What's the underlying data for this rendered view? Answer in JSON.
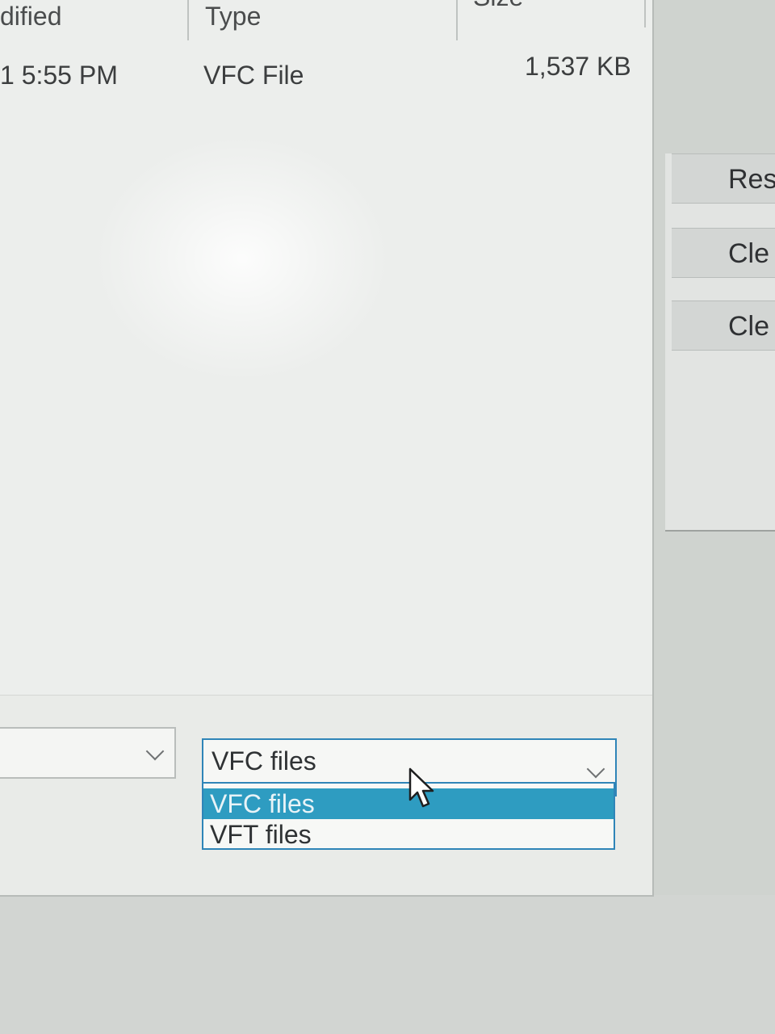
{
  "columns": {
    "modified": "dified",
    "type": "Type",
    "size": "Size"
  },
  "file_row": {
    "modified": "1 5:55 PM",
    "type": "VFC File",
    "size": "1,537 KB"
  },
  "side_buttons": [
    "Res",
    "Cle",
    "Cle"
  ],
  "filter": {
    "selected_value": "VFC files",
    "options": [
      "VFC files",
      "VFT files"
    ],
    "highlighted_index": 0
  },
  "colors": {
    "highlight": "#2e9cc1",
    "focus_border": "#2f85b8"
  },
  "icons": {
    "dropdown": "chevron-down-icon",
    "pointer": "mouse-cursor-icon"
  }
}
